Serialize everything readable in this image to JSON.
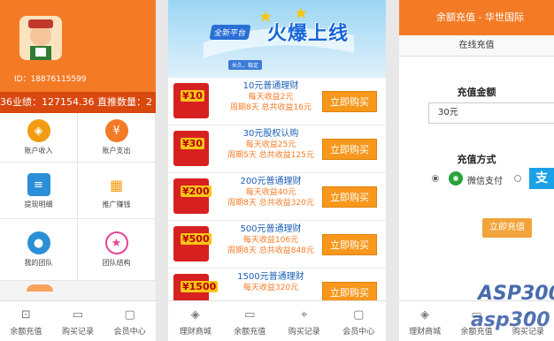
{
  "panel1": {
    "user_id": "ID：18876115599",
    "stats": "36业绩：127154.36 直推数量：2",
    "grid": [
      {
        "label": "账户收入",
        "icon": "wallet-icon",
        "color": "#f39c12"
      },
      {
        "label": "账户支出",
        "icon": "money-bag-icon",
        "color": "#f47b26"
      },
      {
        "label": "提现明细",
        "icon": "document-icon",
        "color": "#2a8fd6"
      },
      {
        "label": "推广赚钱",
        "icon": "qrcode-icon",
        "color": "#f39c12"
      },
      {
        "label": "我的团队",
        "icon": "team-icon",
        "color": "#2a8fd6"
      },
      {
        "label": "团队结构",
        "icon": "star-icon",
        "color": "#e84393"
      }
    ],
    "tabs": [
      {
        "label": "余额充值",
        "icon": "recharge-icon"
      },
      {
        "label": "购买记录",
        "icon": "ticket-icon"
      },
      {
        "label": "会员中心",
        "icon": "chat-icon"
      }
    ]
  },
  "panel2": {
    "banner": {
      "platform": "全新平台",
      "headline": "火爆上线",
      "tagline": "长久，稳定"
    },
    "products": [
      {
        "coupon": "¥10",
        "name": "10元普通理财",
        "daily": "每天收益2元",
        "period": "周期8天 总共收益16元",
        "buy": "立即购买"
      },
      {
        "coupon": "¥30",
        "name": "30元股权认购",
        "daily": "每天收益25元",
        "period": "周期5天 总共收益125元",
        "buy": "立即购买"
      },
      {
        "coupon": "¥200",
        "name": "200元普通理财",
        "daily": "每天收益40元",
        "period": "周期8天 总共收益320元",
        "buy": "立即购买"
      },
      {
        "coupon": "¥500",
        "name": "500元普通理财",
        "daily": "每天收益106元",
        "period": "周期8天 总共收益848元",
        "buy": "立即购买"
      },
      {
        "coupon": "¥1500",
        "name": "1500元普通理财",
        "daily": "每天收益320元",
        "period": "",
        "buy": "立即购买"
      }
    ],
    "tabs": [
      {
        "label": "理财商城",
        "icon": "wallet-icon"
      },
      {
        "label": "余额充值",
        "icon": "ticket-icon"
      },
      {
        "label": "购买记录",
        "icon": "location-icon"
      },
      {
        "label": "会员中心",
        "icon": "chat-icon"
      }
    ]
  },
  "panel3": {
    "title": "余额充值 - 华世国际",
    "tab": "在线充值",
    "amount_label": "充值金额",
    "amount_value": "30元",
    "method_label": "充值方式",
    "wechat": "微信支付",
    "alipay_glyph": "支",
    "submit": "立即充值",
    "tabs": [
      {
        "label": "理财商城",
        "icon": "wallet-icon"
      },
      {
        "label": "余额充值",
        "icon": "ticket-icon"
      },
      {
        "label": "购买记录",
        "icon": "location-icon"
      }
    ]
  },
  "watermark": {
    "line1": "ASP300",
    "line2": "asp300"
  }
}
